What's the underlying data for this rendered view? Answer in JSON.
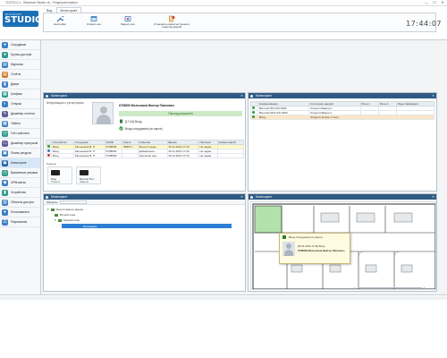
{
  "window": {
    "title": "ТСОТ4.0.1 - Biosmart Studio v6 - Fingerprint station",
    "buttons": [
      "—",
      "☐",
      "✕"
    ]
  },
  "logo": {
    "brand": "BIOSMART",
    "product": "STUDIO"
  },
  "ribbon": {
    "tabs": [
      "Вид",
      "Мониторинг"
    ],
    "buttons": [
      {
        "label": "Настройки",
        "icon": "wrench-icon"
      },
      {
        "label": "Открыть все",
        "icon": "window-icon"
      },
      {
        "label": "Закрыть все",
        "icon": "close-windows-icon"
      },
      {
        "label": "Установить режим экстренного открытия дверей",
        "icon": "emergency-door-icon"
      }
    ]
  },
  "clock": "17:44:07",
  "sidebar": {
    "items": [
      {
        "label": "Сотрудники",
        "color": "#3b7fc4"
      },
      {
        "label": "Группы доступа",
        "color": "#2e9a8e"
      },
      {
        "label": "Журналы",
        "color": "#3b7fc4"
      },
      {
        "label": "Отчёты",
        "color": "#d17b24"
      },
      {
        "label": "Двери",
        "color": "#3b7fc4"
      },
      {
        "label": "Графики",
        "color": "#2e9a8e"
      },
      {
        "label": "Отпуска",
        "color": "#3b7fc4"
      },
      {
        "label": "Дизайнер отчётов",
        "color": "#5d5d9a"
      },
      {
        "label": "Табели",
        "color": "#3b7fc4"
      },
      {
        "label": "Учёт рабочего",
        "color": "#2e9a8e"
      },
      {
        "label": "Дизайнер пропусков",
        "color": "#5d5d9a"
      },
      {
        "label": "Планы ресурсы",
        "color": "#3b7fc4"
      },
      {
        "label": "Мониторинг",
        "color": "#1f5fa6"
      },
      {
        "label": "Временные режимы",
        "color": "#2e9a8e"
      },
      {
        "label": "ОРМ-метки",
        "color": "#3b7fc4"
      },
      {
        "label": "Устройства",
        "color": "#2e9a8e"
      },
      {
        "label": "Объекты доступа",
        "color": "#3b7fc4"
      },
      {
        "label": "Пользователи",
        "color": "#3b7fc4"
      },
      {
        "label": "Разрешения",
        "color": "#3b7fc4"
      }
    ]
  },
  "panel_monitoring": {
    "title": "Мониторинг",
    "info_label": "Информация о регистрации",
    "employee_name": "6708659 Мельников Виктор Павлович",
    "pass_status": "Проход разрешён",
    "event_time": "[17:44] Вход",
    "event_detail": "Вход сотрудника (по карте)",
    "columns": [
      "",
      "Устройство",
      "Сотрудник",
      "Таб№",
      "Карта",
      "Событие",
      "Время",
      "Причина",
      "Комментарий"
    ],
    "rows": [
      [
        "",
        "Вход",
        "Мельников В. П.",
        "6708659",
        "889077",
        "Вход сотрудн...",
        "25.11.2016 17:44",
        "Не задан",
        ""
      ],
      [
        "",
        "Вход",
        "Мельников В. П.",
        "6708659",
        "",
        "Добавление...",
        "25.11.2016 17:43",
        "Не задан",
        ""
      ],
      [
        "",
        "Вход",
        "Мельников В. П.",
        "6708659",
        "",
        "Удаление кар...",
        "25.11.2016 17:43",
        "Не задан",
        ""
      ]
    ],
    "readers_label": "Ридеры",
    "readers": [
      {
        "name": "Вход",
        "state": "Открыто"
      },
      {
        "name": "Biosmart Prox",
        "state": "Закрыто"
      }
    ]
  },
  "panel_devices": {
    "title": "Мониторинг",
    "columns": [
      "",
      "Наименование",
      "Состояние дверей",
      "Реле 1",
      "Реле 2",
      "Идентификация"
    ],
    "rows": [
      [
        "",
        "Biosmart 5M-S/N 0099",
        "Открыто/Закрыто",
        "",
        "",
        ""
      ],
      [
        "",
        "Biosmart Mini-S/N 0003",
        "Открыто/Закрыто",
        "",
        "",
        ""
      ],
      [
        "",
        "Вход",
        "Открыто (4 мин. 2 сек.)",
        "",
        "",
        ""
      ]
    ]
  },
  "panel_objects": {
    "title": "Мониторинг",
    "toolbar_label": "Объекты",
    "tree": [
      "Многоэтажное здание",
      "Второй этаж",
      "Первый этаж",
      "Проходная"
    ]
  },
  "panel_map": {
    "title": "Мониторинг",
    "popup_title": "Вход сотрудника (по карте)",
    "popup_lines": [
      "[25.11.2016 17:44] Вход",
      "6708659 Мельников Виктор Павлович"
    ],
    "zoom_min": "−",
    "zoom_max": "+"
  }
}
